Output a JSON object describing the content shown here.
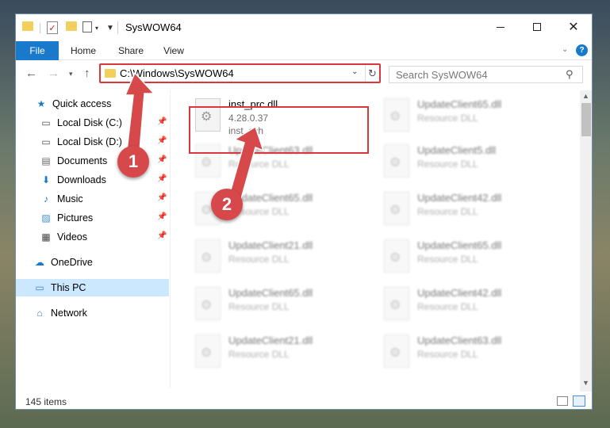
{
  "window": {
    "title": "SysWOW64",
    "min_label": "",
    "close_label": "✕"
  },
  "ribbon": {
    "tabs": [
      {
        "label": "File"
      },
      {
        "label": "Home"
      },
      {
        "label": "Share"
      },
      {
        "label": "View"
      }
    ]
  },
  "address": {
    "path": "C:\\Windows\\SysWOW64"
  },
  "search": {
    "placeholder": "Search SysWOW64"
  },
  "sidebar": {
    "items": [
      {
        "label": "Quick access",
        "icon": "star-icon"
      },
      {
        "label": "Local Disk (C:)",
        "icon": "drive-icon",
        "pinned": true
      },
      {
        "label": "Local Disk (D:)",
        "icon": "drive-icon",
        "pinned": true
      },
      {
        "label": "Documents",
        "icon": "documents-icon",
        "pinned": true
      },
      {
        "label": "Downloads",
        "icon": "downloads-icon",
        "pinned": true
      },
      {
        "label": "Music",
        "icon": "music-icon",
        "pinned": true
      },
      {
        "label": "Pictures",
        "icon": "pictures-icon",
        "pinned": true
      },
      {
        "label": "Videos",
        "icon": "videos-icon",
        "pinned": true
      },
      {
        "label": "OneDrive",
        "icon": "cloud-icon"
      },
      {
        "label": "This PC",
        "icon": "computer-icon",
        "selected": true
      },
      {
        "label": "Network",
        "icon": "network-icon"
      }
    ]
  },
  "files": [
    {
      "name": "inst_prc.dll",
      "version": "4.28.0.37",
      "description": "inst_sch"
    },
    {
      "name": "UpdateClient65.dll",
      "description": "Resource DLL"
    },
    {
      "name": "UpdateClient63.dll",
      "description": "Resource DLL"
    },
    {
      "name": "UpdateClient5.dll",
      "description": "Resource DLL"
    },
    {
      "name": "UpdateClient65.dll",
      "description": "Resource DLL"
    },
    {
      "name": "UpdateClient42.dll",
      "description": "Resource DLL"
    },
    {
      "name": "UpdateClient21.dll",
      "description": "Resource DLL"
    },
    {
      "name": "UpdateClient65.dll",
      "description": "Resource DLL"
    },
    {
      "name": "UpdateClient65.dll",
      "description": "Resource DLL"
    },
    {
      "name": "UpdateClient42.dll",
      "description": "Resource DLL"
    },
    {
      "name": "UpdateClient21.dll",
      "description": "Resource DLL"
    },
    {
      "name": "UpdateClient63.dll",
      "description": "Resource DLL"
    }
  ],
  "status": {
    "count_text": "145 items"
  },
  "annotations": {
    "step1": "1",
    "step2": "2"
  },
  "colors": {
    "accent": "#1979ca",
    "highlight": "#d9363e",
    "selection": "#cce8ff"
  }
}
